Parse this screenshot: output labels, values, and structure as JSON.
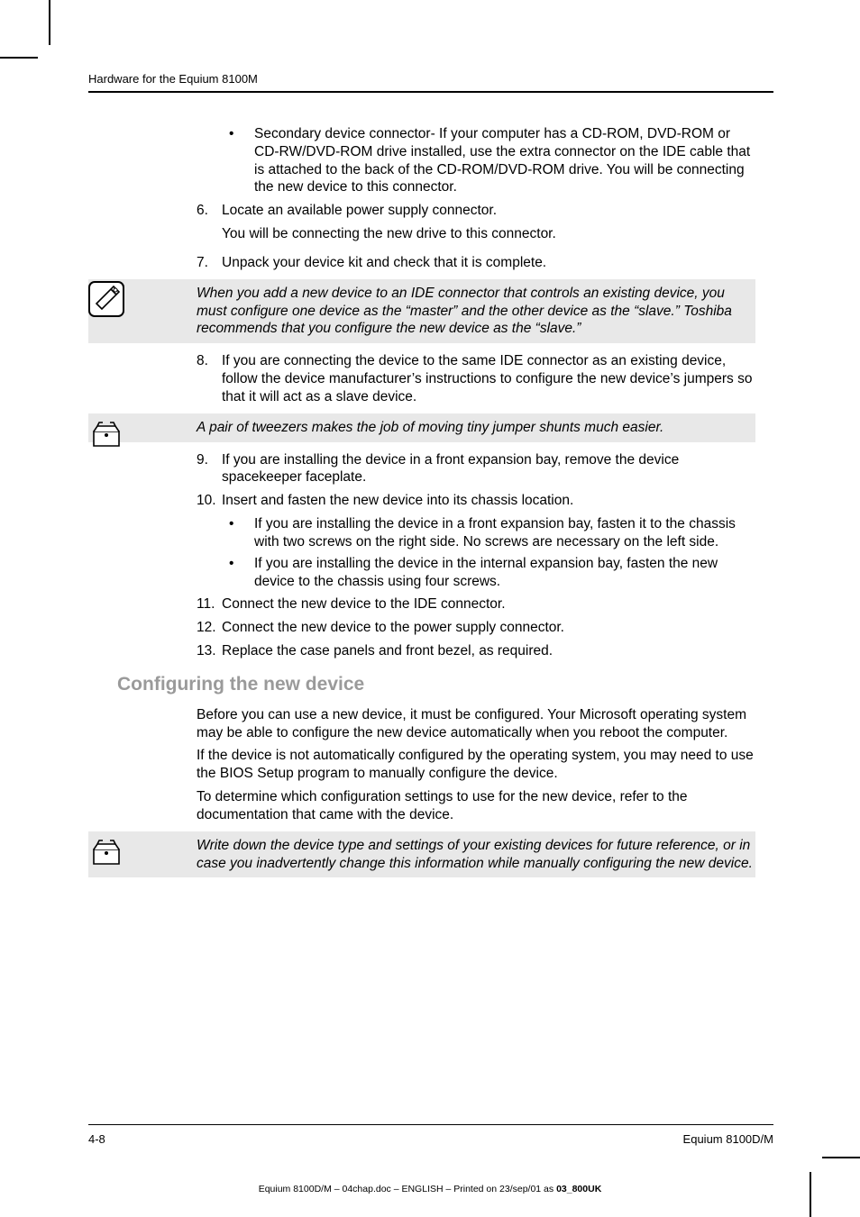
{
  "header": {
    "running_head": "Hardware for the Equium 8100M"
  },
  "bullets_top": [
    "Secondary device connector- If your computer has a CD-ROM, DVD-ROM or CD-RW/DVD-ROM drive installed, use the extra connector on the IDE cable that is attached to the back of the CD-ROM/DVD-ROM drive. You will be connecting the new device to this connector."
  ],
  "steps_a": [
    {
      "n": "6.",
      "t": "Locate an available power supply connector.",
      "sub": "You will be connecting the new drive to this connector."
    },
    {
      "n": "7.",
      "t": "Unpack your device kit and check that it is complete."
    }
  ],
  "note1": "When you add a new device to an IDE connector that controls an existing device, you must configure one device as the “master” and the other device as the “slave.” Toshiba recommends that you configure the new device as the “slave.”",
  "steps_b": [
    {
      "n": "8.",
      "t": "If you are connecting the device to the same IDE connector as an existing device, follow the device manufacturer’s instructions to configure the new device’s jumpers so that it will act as a slave device."
    }
  ],
  "note2": "A pair of tweezers makes the job of moving tiny jumper shunts much easier.",
  "steps_c": [
    {
      "n": "9.",
      "t": "If you are installing the device in a front expansion bay, remove the device spacekeeper faceplate."
    },
    {
      "n": "10.",
      "t": "Insert and fasten the new device into its chassis location."
    }
  ],
  "bullets_mid": [
    "If you are installing the device in a front expansion bay, fasten it to the chassis with two screws on the right side. No screws are necessary on the left side.",
    "If you are installing the device in the internal expansion bay, fasten the new device to the chassis using four screws."
  ],
  "steps_d": [
    {
      "n": "11.",
      "t": "Connect the new device to the IDE connector."
    },
    {
      "n": "12.",
      "t": "Connect the new device to the power supply connector."
    },
    {
      "n": "13.",
      "t": "Replace the case panels and front bezel, as required."
    }
  ],
  "heading2": "Configuring the new device",
  "paras": [
    "Before you can use a new device, it must be configured. Your Microsoft operating system may be able to configure the new device automatically when you reboot the computer.",
    "If the device is not automatically configured by the operating system, you may need to use the BIOS Setup program to manually configure the device.",
    "To determine which configuration settings to use for the new device, refer to the documentation that came with the device."
  ],
  "note3": "Write down the device type and settings of your existing devices for future reference, or in case you inadvertently change this information while manually configuring the new device.",
  "footer": {
    "page": "4-8",
    "model": "Equium 8100D/M"
  },
  "printline": {
    "prefix": "Equium 8100D/M  – 04chap.doc – ENGLISH – Printed on 23/sep/01 as ",
    "bold": "03_800UK"
  }
}
